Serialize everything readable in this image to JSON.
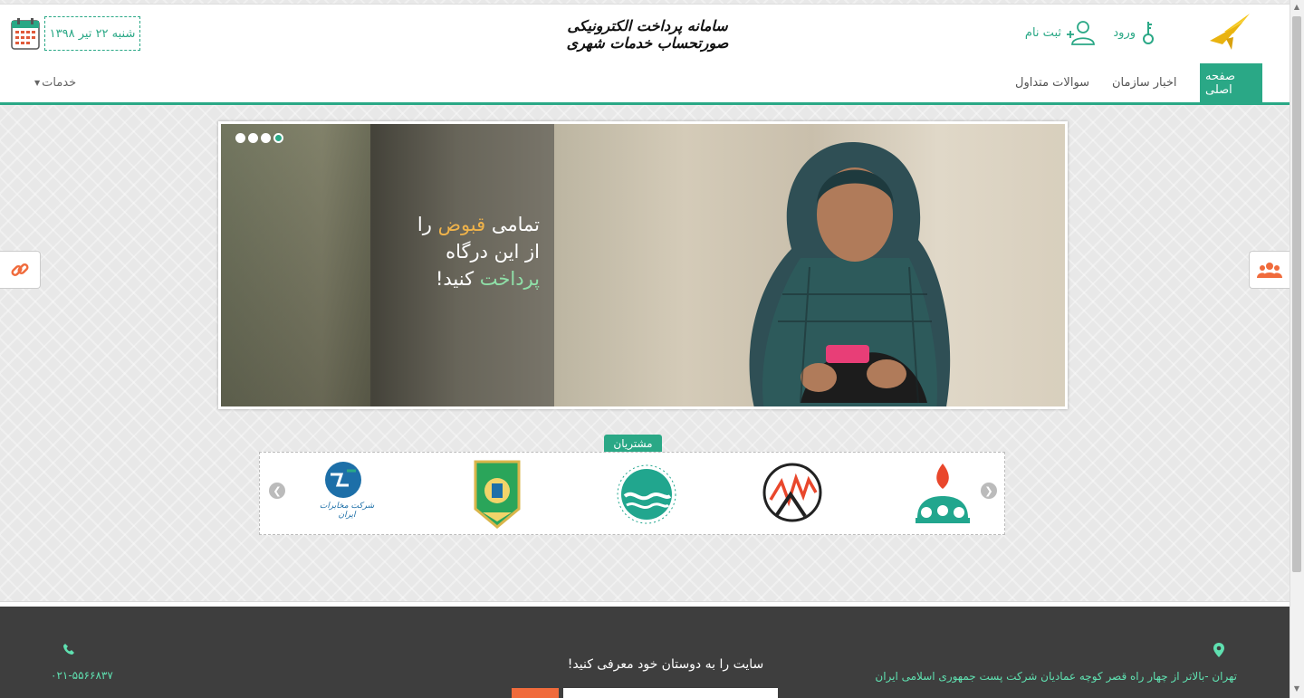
{
  "header": {
    "site_title": "سامانه پرداخت الکترونیکی صورتحساب خدمات شهری",
    "login_label": "ورود",
    "signup_label": "ثبت نام",
    "date_text": "شنبه ۲۲ تیر ۱۳۹۸"
  },
  "nav": {
    "home": "صفحه اصلی",
    "news": "اخبار سازمان",
    "faq": "سوالات متداول",
    "services": "خدمات"
  },
  "banner": {
    "line1_a": "تمامی ",
    "line1_b": "قبوض",
    "line1_c": " را",
    "line2": "از این درگاه",
    "line3_a": "پرداخت",
    "line3_b": " کنید!"
  },
  "customers": {
    "label": "مشتریان",
    "logos": [
      "gas-company-logo",
      "power-company-logo",
      "water-company-logo",
      "traffic-police-logo",
      "telecom-iran-logo"
    ],
    "telecom_text": "شرکت مخابرات ایران"
  },
  "footer": {
    "phone": "۰۲۱-۵۵۶۶۸۳۷",
    "address": "تهران -بالاتر از چهار راه قصر کوچه عمادیان شرکت پست جمهوری اسلامی ایران",
    "introduce": "سایت را به دوستان خود معرفی کنید!"
  },
  "colors": {
    "accent": "#2aa886",
    "orange": "#f06b3c",
    "footer_bg": "#3e3e3e"
  }
}
